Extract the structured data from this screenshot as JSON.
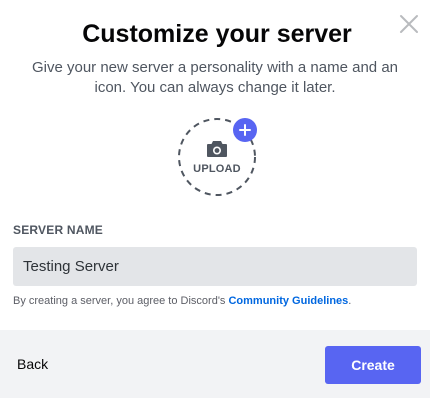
{
  "modal": {
    "title": "Customize your server",
    "subtitle": "Give your new server a personality with a name and an icon. You can always change it later."
  },
  "upload": {
    "label": "UPLOAD",
    "icon": "camera-icon",
    "badge_icon": "plus-icon"
  },
  "form": {
    "server_name_label": "SERVER NAME",
    "server_name_value": "Testing Server",
    "agreement_prefix": "By creating a server, you agree to Discord's ",
    "agreement_link": "Community Guidelines",
    "agreement_suffix": "."
  },
  "footer": {
    "back_label": "Back",
    "create_label": "Create"
  },
  "colors": {
    "accent": "#5865f2",
    "link": "#0067e0",
    "input_bg": "#e3e5e8",
    "footer_bg": "#f2f3f5"
  }
}
